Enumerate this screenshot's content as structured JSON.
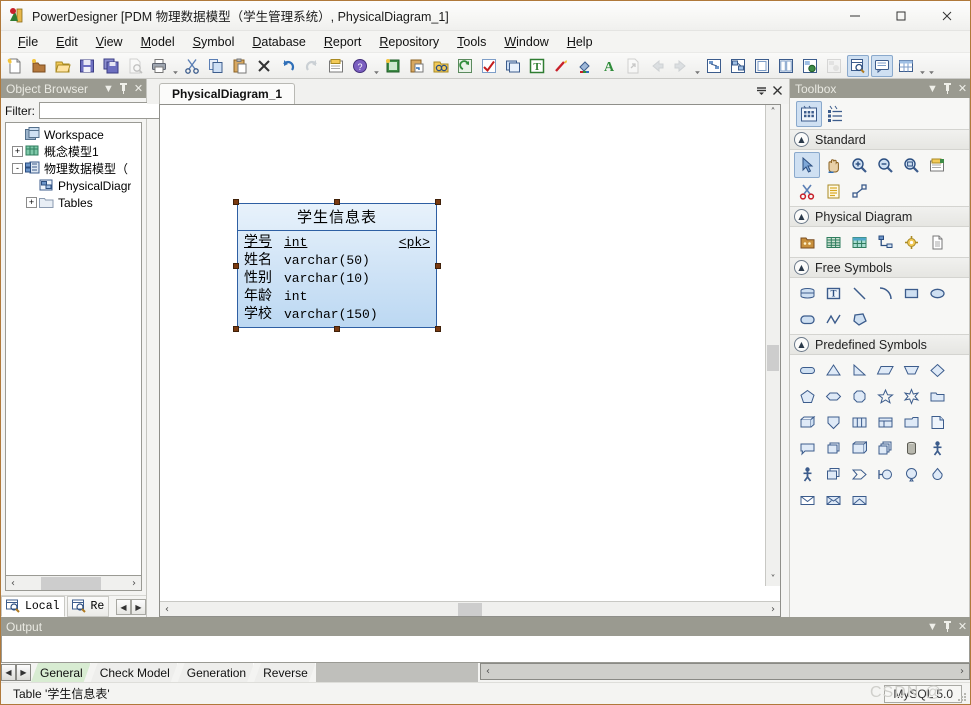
{
  "window": {
    "title": "PowerDesigner [PDM 物理数据模型（学生管理系统）, PhysicalDiagram_1]",
    "app_icon": "powerdesigner-icon",
    "minimize_label": "—",
    "maximize_label": "□",
    "close_label": "✕"
  },
  "menu": {
    "items": [
      {
        "label": "File",
        "accel": "F"
      },
      {
        "label": "Edit",
        "accel": "E"
      },
      {
        "label": "View",
        "accel": "V"
      },
      {
        "label": "Model",
        "accel": "M"
      },
      {
        "label": "Symbol",
        "accel": "S"
      },
      {
        "label": "Database",
        "accel": "D"
      },
      {
        "label": "Report",
        "accel": "R"
      },
      {
        "label": "Repository",
        "accel": "R"
      },
      {
        "label": "Tools",
        "accel": "T"
      },
      {
        "label": "Window",
        "accel": "W"
      },
      {
        "label": "Help",
        "accel": "H"
      }
    ]
  },
  "toolbar": {
    "groups": [
      {
        "name": "standard",
        "buttons": [
          {
            "icon": "new-model-icon",
            "tooltip": "New Model"
          },
          {
            "icon": "new-package-icon",
            "tooltip": "New Package"
          },
          {
            "icon": "open-folder-icon",
            "tooltip": "Open Model"
          },
          {
            "icon": "save-icon",
            "tooltip": "Save"
          },
          {
            "icon": "save-all-icon",
            "tooltip": "Save All"
          },
          {
            "icon": "print-preview-icon",
            "tooltip": "Print Preview"
          },
          {
            "icon": "print-icon",
            "tooltip": "Print"
          },
          {
            "icon": "cut-icon",
            "tooltip": "Cut"
          },
          {
            "icon": "copy-icon",
            "tooltip": "Copy"
          },
          {
            "icon": "paste-icon",
            "tooltip": "Paste"
          },
          {
            "icon": "delete-icon",
            "tooltip": "Delete"
          },
          {
            "icon": "undo-icon",
            "tooltip": "Undo"
          },
          {
            "icon": "redo-icon",
            "tooltip": "Redo",
            "disabled": true
          },
          {
            "icon": "properties-icon",
            "tooltip": "Properties"
          },
          {
            "icon": "help-icon",
            "tooltip": "Help"
          }
        ]
      },
      {
        "name": "model",
        "buttons": [
          {
            "icon": "new-diagram-icon",
            "tooltip": "New Diagram"
          },
          {
            "icon": "paste-object-icon",
            "tooltip": "Paste Object"
          },
          {
            "icon": "find-object-icon",
            "tooltip": "Find Object"
          },
          {
            "icon": "refresh-icon",
            "tooltip": "Refresh"
          },
          {
            "icon": "check-model-icon",
            "tooltip": "Check Model"
          },
          {
            "icon": "symbol-format-icon",
            "tooltip": "Symbol Format"
          },
          {
            "icon": "text-tool-icon",
            "tooltip": "Text"
          },
          {
            "icon": "brush-icon",
            "tooltip": "Format Brush"
          },
          {
            "icon": "fill-color-icon",
            "tooltip": "Fill Color"
          },
          {
            "icon": "font-color-icon",
            "tooltip": "Font Color"
          },
          {
            "icon": "export-icon",
            "tooltip": "Export",
            "disabled": true
          },
          {
            "icon": "back-arrow-icon",
            "tooltip": "Back",
            "disabled": true
          },
          {
            "icon": "forward-arrow-icon",
            "tooltip": "Forward",
            "disabled": true
          }
        ]
      },
      {
        "name": "views",
        "buttons": [
          {
            "icon": "cdm-view-icon",
            "tooltip": "Conceptual Model"
          },
          {
            "icon": "pdm-view-icon",
            "tooltip": "Physical Model"
          },
          {
            "icon": "page-view-icon",
            "tooltip": "Page"
          },
          {
            "icon": "split-view-icon",
            "tooltip": "Split View"
          },
          {
            "icon": "generate-icon",
            "tooltip": "Generate"
          },
          {
            "icon": "preview-disabled-icon",
            "tooltip": "Preview",
            "disabled": true
          },
          {
            "icon": "browser-toggle-icon",
            "tooltip": "Object Browser",
            "pressed": true
          },
          {
            "icon": "output-toggle-icon",
            "tooltip": "Output Window",
            "pressed": true
          },
          {
            "icon": "grid-toggle-icon",
            "tooltip": "Result List"
          }
        ]
      }
    ]
  },
  "browser": {
    "title": "Object Browser",
    "header_buttons": [
      {
        "icon": "chevron-down-icon",
        "label": "▼"
      },
      {
        "icon": "pin-icon",
        "label": "☩"
      },
      {
        "icon": "close-icon",
        "label": "✕"
      }
    ],
    "filter_label": "Filter:",
    "filter_value": "",
    "filter_placeholder": "",
    "tree": [
      {
        "label": "Workspace",
        "icon": "workspace-icon",
        "twisty": "none",
        "indent": 0
      },
      {
        "label": "概念模型1",
        "icon": "cdm-model-icon",
        "twisty": "+",
        "indent": 1
      },
      {
        "label": "物理数据模型（",
        "icon": "pdm-model-icon",
        "twisty": "-",
        "indent": 1
      },
      {
        "label": "PhysicalDiagr",
        "icon": "diagram-icon",
        "twisty": "none",
        "indent": 2
      },
      {
        "label": "Tables",
        "icon": "folder-icon",
        "twisty": "+",
        "indent": 2
      }
    ],
    "tabs": [
      {
        "label": "Local",
        "icon": "local-icon",
        "active": true
      },
      {
        "label": "Re",
        "icon": "repository-icon",
        "active": false
      }
    ],
    "tab_nav": [
      {
        "icon": "nav-left-icon",
        "label": "◄"
      },
      {
        "icon": "nav-right-icon",
        "label": "►"
      }
    ],
    "hscroll": {
      "left_arrow": "‹",
      "right_arrow": "›"
    }
  },
  "diagram": {
    "tab_label": "PhysicalDiagram_1",
    "tabbar_buttons": [
      {
        "icon": "tab-list-icon",
        "label": "≣"
      },
      {
        "icon": "close-icon",
        "label": "✕"
      }
    ],
    "vscroll": {
      "up": "˄",
      "down": "˅"
    },
    "hscroll": {
      "left": "‹",
      "right": "›"
    },
    "table": {
      "name": "学生信息表",
      "columns": [
        {
          "name": "学号",
          "type": "int",
          "key": "<pk>",
          "primary": true
        },
        {
          "name": "姓名",
          "type": "varchar(50)",
          "key": "",
          "primary": false
        },
        {
          "name": "性别",
          "type": "varchar(10)",
          "key": "",
          "primary": false
        },
        {
          "name": "年龄",
          "type": "int",
          "key": "",
          "primary": false
        },
        {
          "name": "学校",
          "type": "varchar(150)",
          "key": "",
          "primary": false
        }
      ],
      "selected": true
    }
  },
  "toolbox": {
    "title": "Toolbox",
    "header_buttons": [
      {
        "icon": "chevron-down-icon",
        "label": "▼"
      },
      {
        "icon": "pin-icon",
        "label": "☩"
      },
      {
        "icon": "close-icon",
        "label": "✕"
      }
    ],
    "top_buttons": [
      {
        "icon": "palette-grid-icon",
        "pressed": true
      },
      {
        "icon": "palette-list-icon",
        "pressed": false
      }
    ],
    "sections": [
      {
        "label": "Standard",
        "collapsed": false,
        "tools": [
          {
            "icon": "pointer-icon",
            "pressed": true
          },
          {
            "icon": "grabber-hand-icon",
            "pressed": false
          },
          {
            "icon": "zoom-in-icon",
            "pressed": false
          },
          {
            "icon": "zoom-out-icon",
            "pressed": false
          },
          {
            "icon": "zoom-fit-icon",
            "pressed": false
          },
          {
            "icon": "note-properties-icon",
            "pressed": false
          },
          {
            "icon": "scissors-icon",
            "pressed": false
          },
          {
            "icon": "note-icon",
            "pressed": false
          },
          {
            "icon": "link-icon",
            "pressed": false
          }
        ]
      },
      {
        "label": "Physical Diagram",
        "collapsed": false,
        "tools": [
          {
            "icon": "package-icon",
            "pressed": false
          },
          {
            "icon": "table-icon",
            "pressed": false
          },
          {
            "icon": "view-table-icon",
            "pressed": false
          },
          {
            "icon": "reference-icon",
            "pressed": false
          },
          {
            "icon": "procedure-icon",
            "pressed": false
          },
          {
            "icon": "file-object-icon",
            "pressed": false
          }
        ]
      },
      {
        "label": "Free Symbols",
        "collapsed": false,
        "tools": [
          {
            "icon": "cylinder-symbol-icon",
            "pressed": false
          },
          {
            "icon": "text-symbol-icon",
            "pressed": false
          },
          {
            "icon": "line-symbol-icon",
            "pressed": false
          },
          {
            "icon": "arc-symbol-icon",
            "pressed": false
          },
          {
            "icon": "rectangle-symbol-icon",
            "pressed": false
          },
          {
            "icon": "ellipse-symbol-icon",
            "pressed": false
          },
          {
            "icon": "rounded-rect-symbol-icon",
            "pressed": false
          },
          {
            "icon": "polyline-symbol-icon",
            "pressed": false
          },
          {
            "icon": "polygon-symbol-icon",
            "pressed": false
          }
        ]
      },
      {
        "label": "Predefined Symbols",
        "collapsed": false,
        "tools": [
          {
            "icon": "capsule-symbol-icon"
          },
          {
            "icon": "triangle-symbol-icon"
          },
          {
            "icon": "right-triangle-symbol-icon"
          },
          {
            "icon": "parallelogram-symbol-icon"
          },
          {
            "icon": "trapezoid-symbol-icon"
          },
          {
            "icon": "diamond-symbol-icon"
          },
          {
            "icon": "pentagon-symbol-icon"
          },
          {
            "icon": "hexagon-flat-symbol-icon"
          },
          {
            "icon": "octagon-symbol-icon"
          },
          {
            "icon": "star4-symbol-icon"
          },
          {
            "icon": "star6-symbol-icon"
          },
          {
            "icon": "folder-symbol-icon"
          },
          {
            "icon": "cube-symbol-icon"
          },
          {
            "icon": "shield-symbol-icon"
          },
          {
            "icon": "columns-symbol-icon"
          },
          {
            "icon": "window-symbol-icon"
          },
          {
            "icon": "open-folder-symbol-icon"
          },
          {
            "icon": "document-symbol-icon"
          },
          {
            "icon": "note-corner-symbol-icon"
          },
          {
            "icon": "stack-symbol-icon"
          },
          {
            "icon": "box3d-symbol-icon"
          },
          {
            "icon": "multi-stack-symbol-icon"
          },
          {
            "icon": "database-cylinder-symbol-icon"
          },
          {
            "icon": "actor-symbol-icon"
          },
          {
            "icon": "actor2-symbol-icon"
          },
          {
            "icon": "layers-symbol-icon"
          },
          {
            "icon": "arrow-pentagon-symbol-icon"
          },
          {
            "icon": "flag-circle-symbol-icon"
          },
          {
            "icon": "balloon-symbol-icon"
          },
          {
            "icon": "drop-symbol-icon"
          },
          {
            "icon": "envelope-symbol-icon"
          },
          {
            "icon": "envelope-open-symbol-icon"
          },
          {
            "icon": "envelope-flat-symbol-icon"
          }
        ]
      }
    ]
  },
  "output": {
    "title": "Output",
    "header_buttons": [
      {
        "icon": "chevron-down-icon",
        "label": "▼"
      },
      {
        "icon": "pin-icon",
        "label": "☩"
      },
      {
        "icon": "close-icon",
        "label": "✕"
      }
    ],
    "tab_nav": [
      {
        "icon": "nav-left-icon",
        "label": "◄"
      },
      {
        "icon": "nav-right-icon",
        "label": "►"
      }
    ],
    "tabs": [
      {
        "label": "General",
        "active": true
      },
      {
        "label": "Check Model",
        "active": false
      },
      {
        "label": "Generation",
        "active": false
      },
      {
        "label": "Reverse",
        "active": false
      }
    ],
    "hscroll": {
      "left": "‹",
      "right": "›"
    }
  },
  "statusbar": {
    "message": "Table '学生信息表'",
    "dbms": "MySQL 5.0",
    "watermark": "CSDN @"
  },
  "colors": {
    "panel_header": "#9a9a90",
    "window_border": "#b0793a",
    "table_border": "#2e5fa3",
    "table_fill": "#cfe3f6",
    "selection_handle": "#7a3a10",
    "active_tab": "#d8ecd2"
  }
}
